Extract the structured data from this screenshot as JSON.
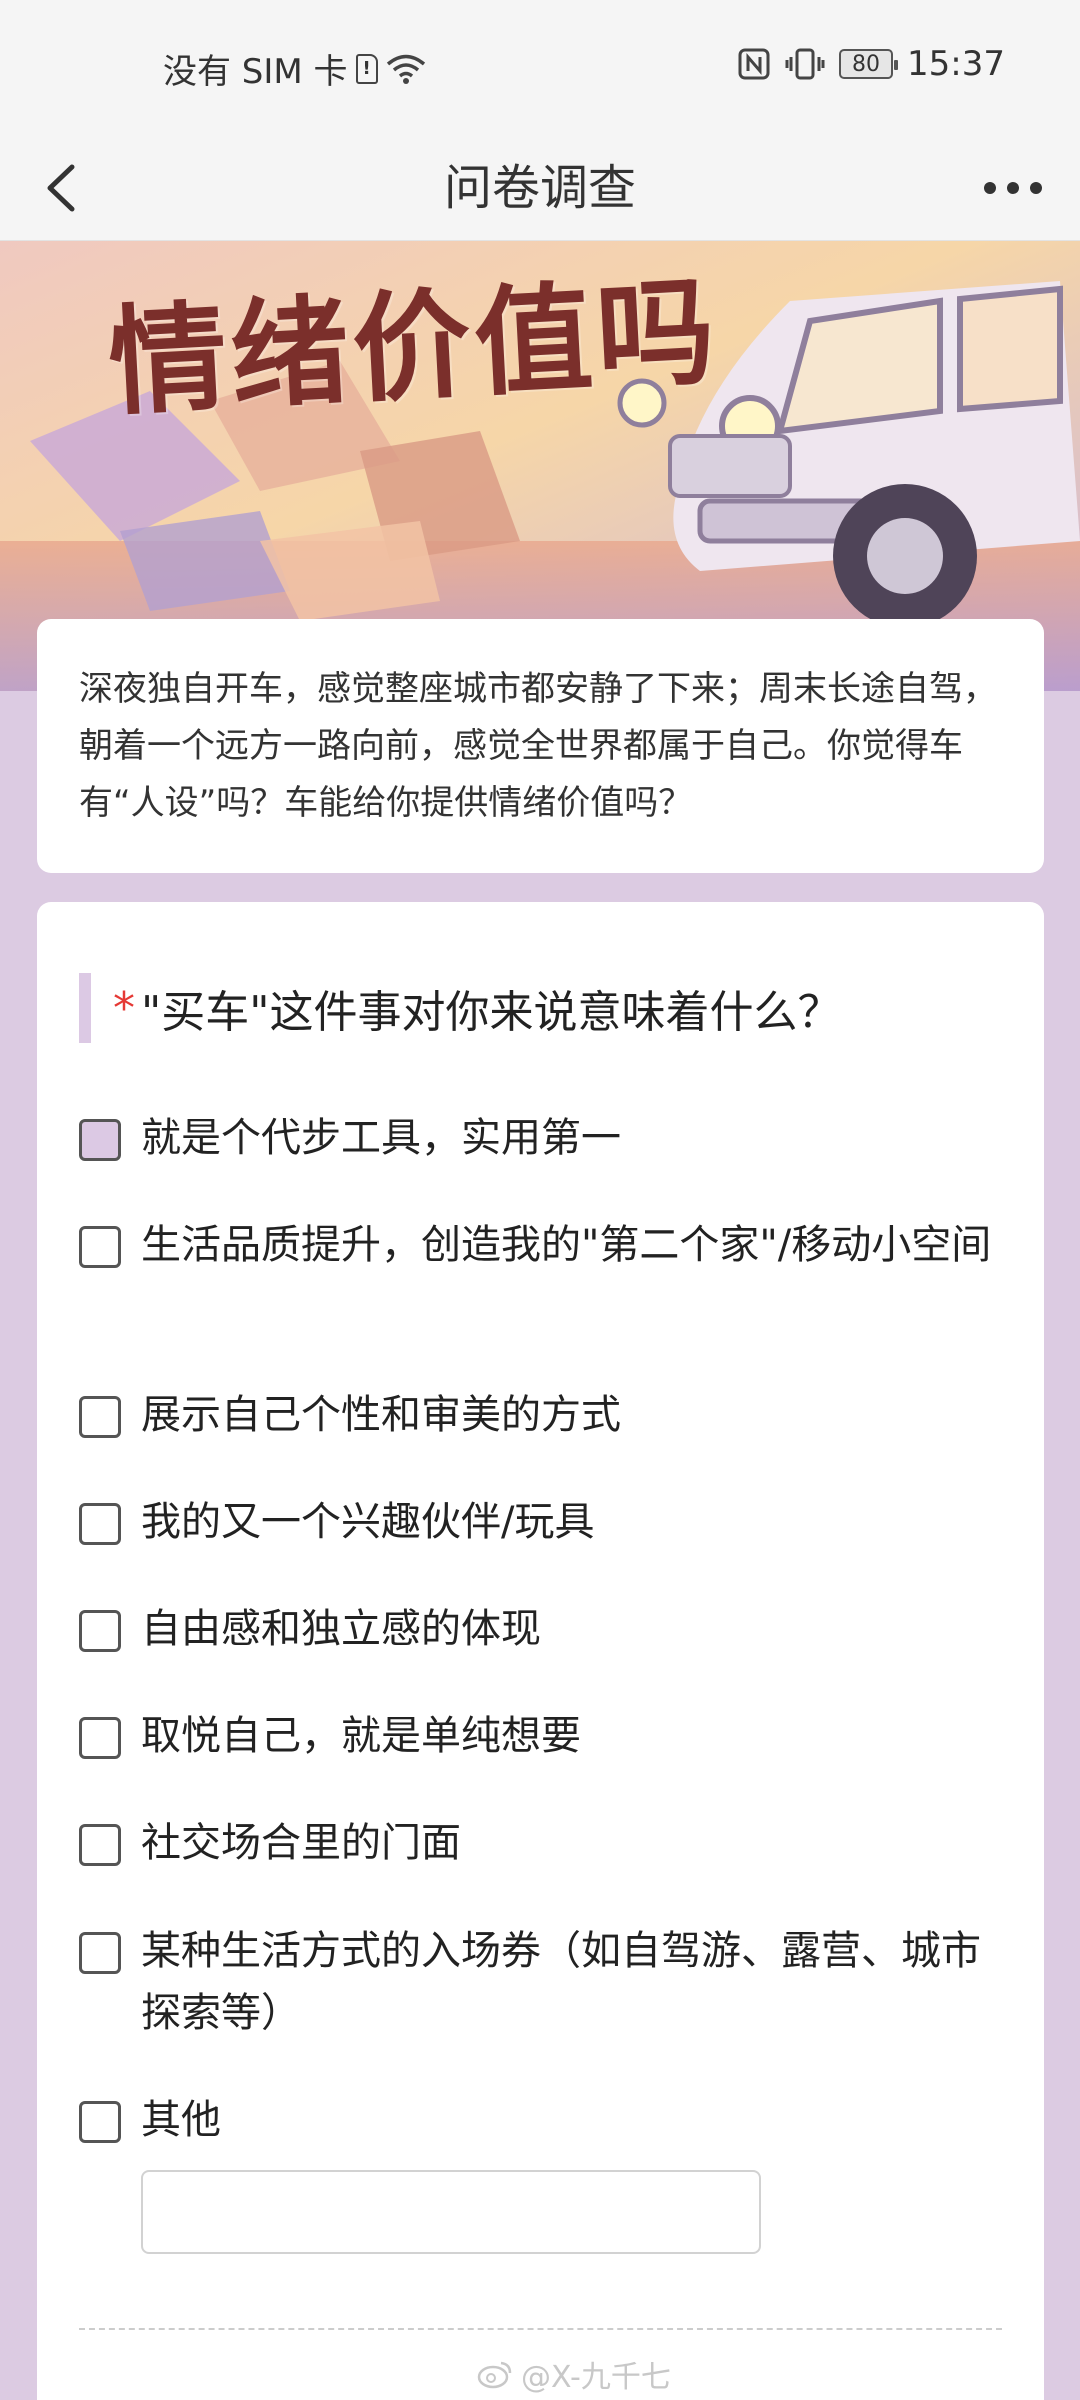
{
  "status_bar": {
    "carrier": "没有 SIM 卡",
    "sim_icon": "!",
    "battery": "80",
    "time": "15:37"
  },
  "header": {
    "title": "问卷调查"
  },
  "banner": {
    "title": "情绪价值吗"
  },
  "intro": {
    "text": "深夜独自开车，感觉整座城市都安静了下来；周末长途自驾，朝着一个远方一路向前，感觉全世界都属于自己。你觉得车有“人设”吗？车能给你提供情绪价值吗？"
  },
  "question": {
    "required_mark": "*",
    "text": "\"买车\"这件事对你来说意味着什么？",
    "options": [
      {
        "label": "就是个代步工具，实用第一",
        "checked": true
      },
      {
        "label": "生活品质提升，创造我的\"第二个家\"/移动小空间",
        "checked": false
      },
      {
        "label": "展示自己个性和审美的方式",
        "checked": false
      },
      {
        "label": "我的又一个兴趣伙伴/玩具",
        "checked": false
      },
      {
        "label": "自由感和独立感的体现",
        "checked": false
      },
      {
        "label": "取悦自己，就是单纯想要",
        "checked": false
      },
      {
        "label": "社交场合里的门面",
        "checked": false
      },
      {
        "label": "某种生活方式的入场券（如自驾游、露营、城市探索等）",
        "checked": false
      },
      {
        "label": "其他",
        "checked": false
      }
    ],
    "other_input_value": ""
  },
  "watermark": "@X-九千七",
  "colors": {
    "page_bg": "#dccbe2",
    "accent": "#dcc9e4",
    "required": "#e53935"
  }
}
